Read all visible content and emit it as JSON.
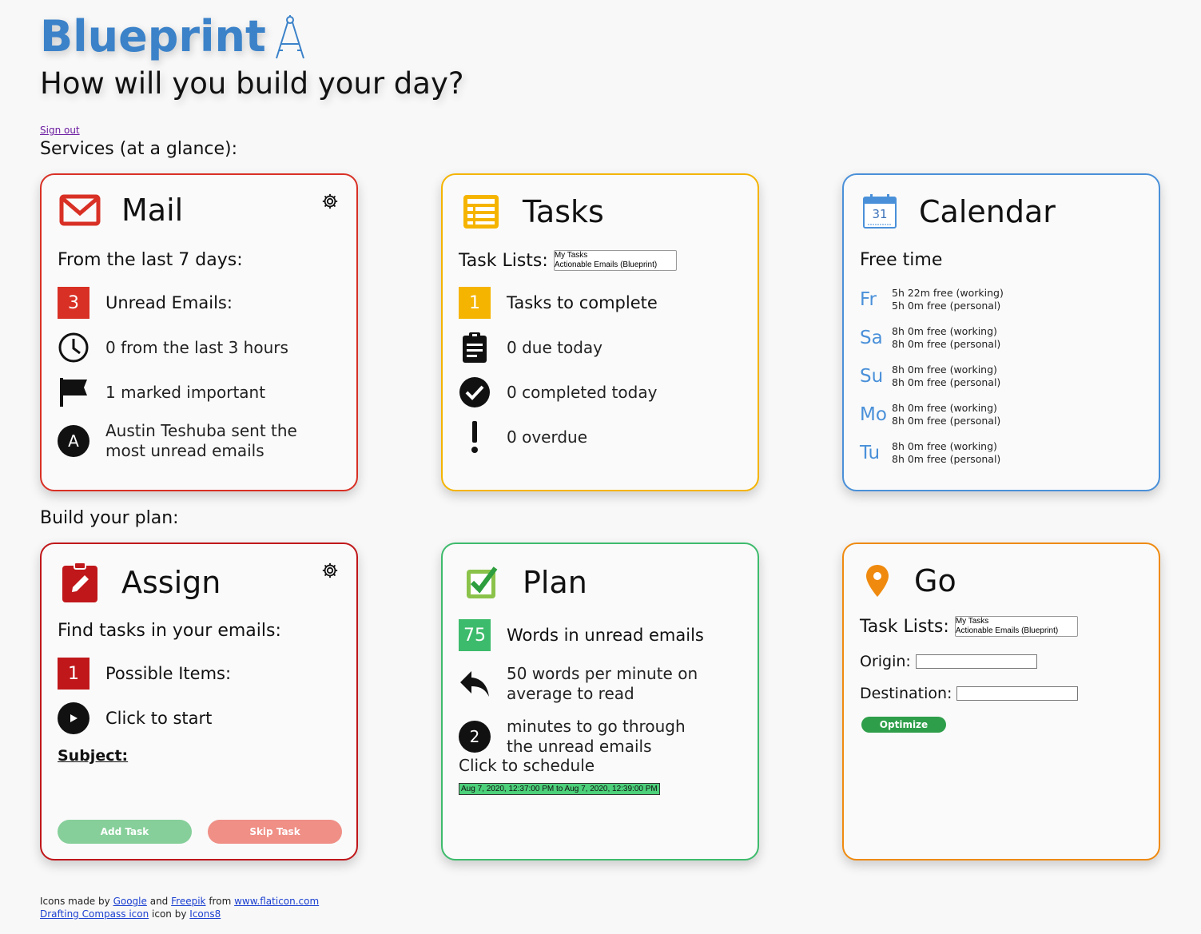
{
  "header": {
    "logo": "Blueprint",
    "tagline": "How will you build your day?",
    "sign_out": "Sign out"
  },
  "sections": {
    "services": "Services (at a glance):",
    "build": "Build your plan:"
  },
  "mail": {
    "title": "Mail",
    "subtitle": "From the last 7 days:",
    "unread_count": "3",
    "unread_label": "Unread Emails:",
    "recent": "0 from the last 3 hours",
    "important": "1 marked important",
    "sender_initial": "A",
    "sender": "Austin Teshuba sent the most unread emails",
    "accent": "#d93025"
  },
  "tasks": {
    "title": "Tasks",
    "lists_label": "Task Lists:",
    "lists_options": [
      "My Tasks",
      "Actionable Emails (Blueprint)"
    ],
    "count": "1",
    "count_label": "Tasks to complete",
    "due": "0 due today",
    "completed": "0 completed today",
    "overdue": "0 overdue",
    "accent": "#f5b400"
  },
  "calendar": {
    "title": "Calendar",
    "icon_day": "31",
    "subtitle": "Free time",
    "days": [
      {
        "day": "Fr",
        "working": "5h 22m free (working)",
        "personal": "5h 0m free (personal)"
      },
      {
        "day": "Sa",
        "working": "8h 0m free (working)",
        "personal": "8h 0m free (personal)"
      },
      {
        "day": "Su",
        "working": "8h 0m free (working)",
        "personal": "8h 0m free (personal)"
      },
      {
        "day": "Mo",
        "working": "8h 0m free (working)",
        "personal": "8h 0m free (personal)"
      },
      {
        "day": "Tu",
        "working": "8h 0m free (working)",
        "personal": "8h 0m free (personal)"
      }
    ],
    "accent": "#4a90d9"
  },
  "assign": {
    "title": "Assign",
    "subtitle": "Find tasks in your emails:",
    "count": "1",
    "count_label": "Possible Items:",
    "start": "Click to start",
    "subject": "Subject:",
    "add_btn": "Add Task",
    "skip_btn": "Skip Task",
    "accent": "#c0171a"
  },
  "plan": {
    "title": "Plan",
    "words": "75",
    "words_label": "Words in unread emails",
    "rate": "50 words per minute on average to read",
    "minutes": "2",
    "minutes_label": "minutes to go through the unread emails",
    "schedule": "Click to schedule",
    "slot": "Aug 7, 2020, 12:37:00 PM to Aug 7, 2020, 12:39:00 PM",
    "accent": "#3dbb6c"
  },
  "go": {
    "title": "Go",
    "lists_label": "Task Lists:",
    "lists_options": [
      "My Tasks",
      "Actionable Emails (Blueprint)"
    ],
    "origin": "Origin:",
    "destination": "Destination:",
    "optimize": "Optimize",
    "accent": "#ef8a0f"
  },
  "footer": {
    "line1_pre": "Icons made by",
    "google": "Google",
    "and": "and",
    "freepik": "Freepik",
    "from": "from",
    "flaticon": "www.flaticon.com",
    "compass_link": "Drafting Compass icon",
    "icon_by": "icon by",
    "icons8": "Icons8"
  }
}
